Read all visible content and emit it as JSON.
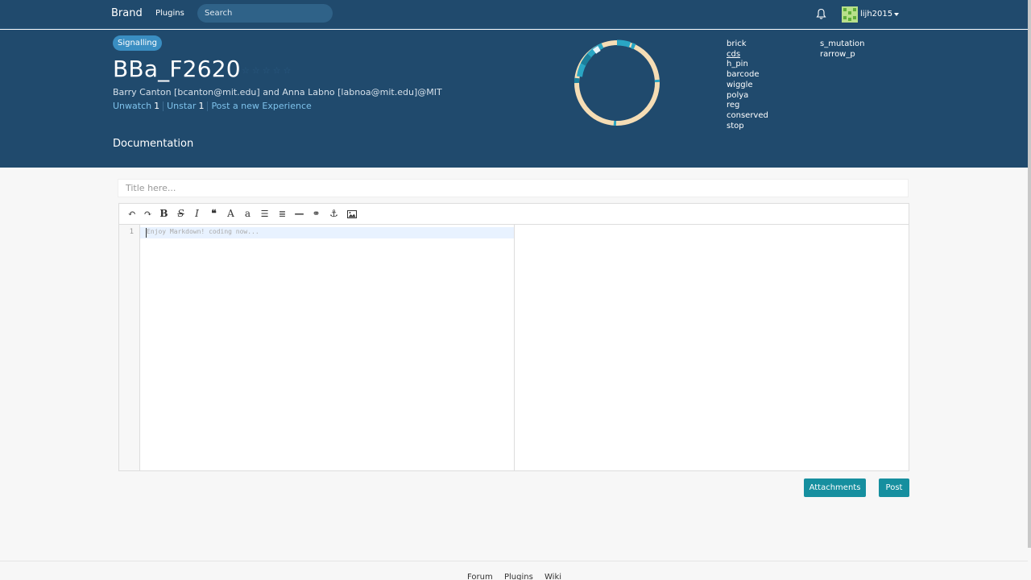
{
  "navbar": {
    "brand": "Brand",
    "plugins_link": "Plugins",
    "search_placeholder": "Search",
    "username": "lijh2015"
  },
  "header": {
    "badge": "Signalling",
    "part_title": "BBa_F2620",
    "stars": "☆☆☆☆☆",
    "authors": "Barry Canton [bcanton@mit.edu] and Anna Labno [labnoa@mit.edu]@MIT",
    "unwatch_label": "Unwatch",
    "unwatch_count": "1",
    "unstar_label": "Unstar",
    "unstar_count": "1",
    "post_experience": "Post a new Experience",
    "documentation": "Documentation"
  },
  "feature_legend": {
    "col1": [
      "brick",
      "cds",
      "h_pin",
      "barcode",
      "wiggle",
      "polya",
      "reg",
      "conserved",
      "stop"
    ],
    "col2": [
      "s_mutation",
      "rarrow_p"
    ]
  },
  "editor": {
    "title_placeholder": "Title here...",
    "line_number": "1",
    "code_placeholder": "Enjoy Markdown! coding now..."
  },
  "buttons": {
    "attachments": "Attachments",
    "post": "Post"
  },
  "footer": {
    "links": [
      "Forum",
      "Plugins",
      "Wiki"
    ]
  },
  "colors": {
    "header_bg": "#204a6d",
    "accent_button": "#168f9f",
    "ring_main": "#f5ddb5",
    "ring_feature": "#2aa6c4"
  }
}
